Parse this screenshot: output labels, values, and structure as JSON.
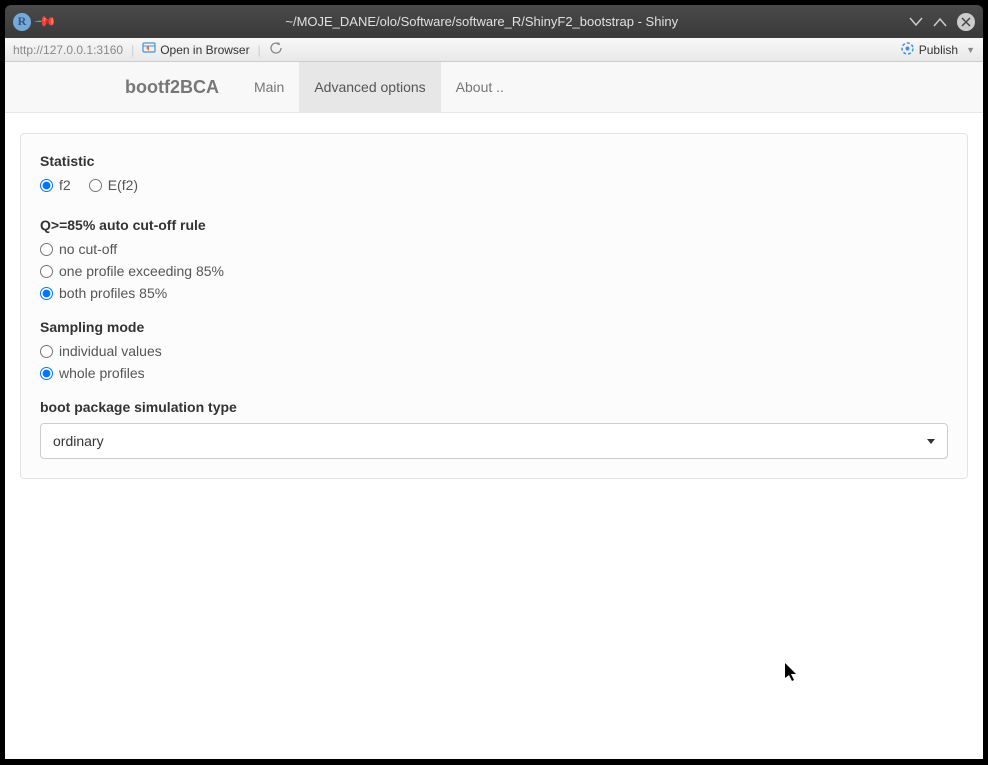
{
  "window": {
    "title": "~/MOJE_DANE/olo/Software/software_R/ShinyF2_bootstrap - Shiny",
    "app_icon_letter": "R"
  },
  "toolbar": {
    "url": "http://127.0.0.1:3160",
    "open_browser": "Open in Browser",
    "publish": "Publish"
  },
  "navbar": {
    "brand": "bootf2BCA",
    "tabs": [
      {
        "label": "Main"
      },
      {
        "label": "Advanced options"
      },
      {
        "label": "About .."
      }
    ]
  },
  "panel": {
    "statistic": {
      "label": "Statistic",
      "options": [
        {
          "label": "f2",
          "checked": true
        },
        {
          "label": "E(f2)",
          "checked": false
        }
      ]
    },
    "cutoff": {
      "label": "Q>=85% auto cut-off rule",
      "options": [
        {
          "label": "no cut-off",
          "checked": false
        },
        {
          "label": "one profile exceeding 85%",
          "checked": false
        },
        {
          "label": "both profiles 85%",
          "checked": true
        }
      ]
    },
    "sampling": {
      "label": "Sampling mode",
      "options": [
        {
          "label": "individual values",
          "checked": false
        },
        {
          "label": "whole profiles",
          "checked": true
        }
      ]
    },
    "simtype": {
      "label": "boot package simulation type",
      "selected": "ordinary"
    }
  }
}
